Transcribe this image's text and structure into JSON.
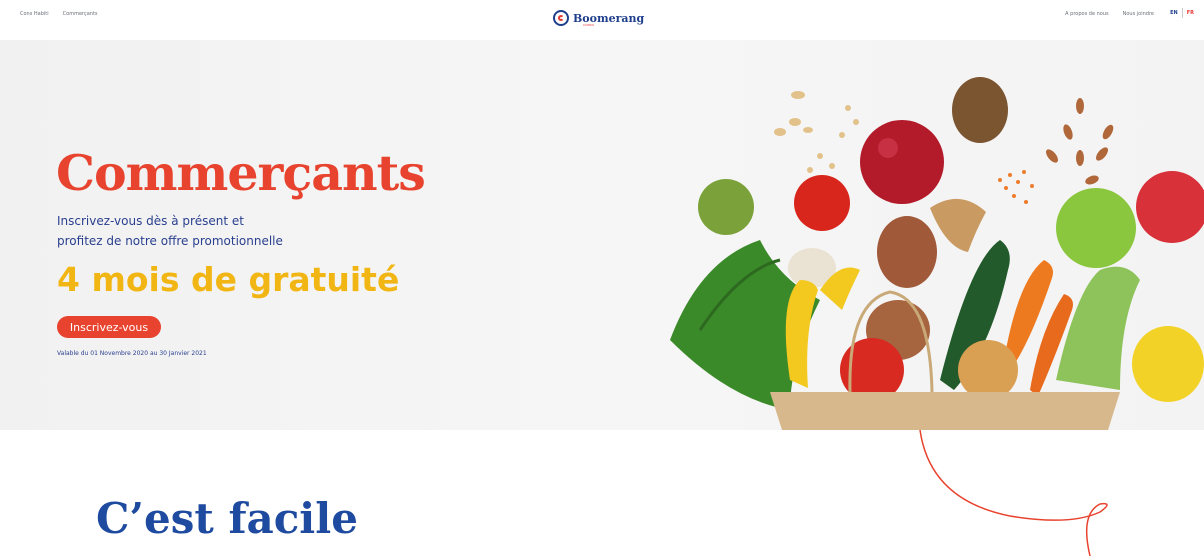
{
  "nav": {
    "left_items": [
      "Cons Habiti",
      "Commerçants"
    ],
    "brand": "Boomerang",
    "brand_sub": "CONSO",
    "right_items": [
      "A propos de nous",
      "Nous joindre"
    ],
    "lang_en": "EN",
    "lang_fr": "FR"
  },
  "hero": {
    "title": "Commerçants",
    "subtitle_line1": "Inscrivez-vous dès à présent et",
    "subtitle_line2": "profitez de notre offre promotionnelle",
    "offer": "4 mois de gratuité",
    "cta_label": "Inscrivez-vous",
    "validity": "Valable du 01 Novembre 2020 au 30 Janvier 2021"
  },
  "section": {
    "title": "C’est facile"
  },
  "colors": {
    "accent_red": "#e8432e",
    "brand_blue": "#1f3f8c",
    "offer_yellow": "#f2b614"
  },
  "icons": {
    "brand_logo": "boomerang-logo-icon",
    "illustration": "grocery-bag-produce-illustration"
  }
}
